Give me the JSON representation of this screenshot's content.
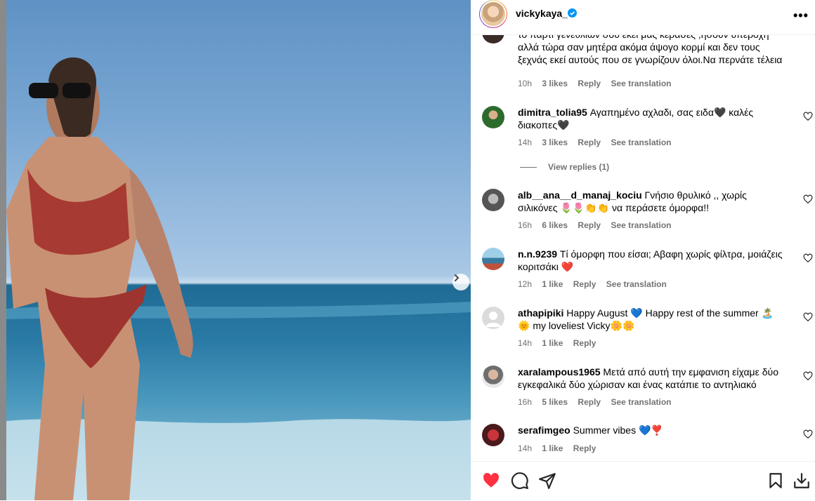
{
  "post": {
    "username": "vickykaya_",
    "verified": true,
    "more_icon": "more-horizontal-icon"
  },
  "comments": [
    {
      "text": "το πάρτι γενεθλίων σου εκεί μας κερασες ,ήσουν υπέροχη αλλά τώρα σαν μητέρα ακόμα άψογο κορμί και δεν τους ξεχνάς εκεί αυτούς που σε γνωρίζουν όλοι.Να περνάτε τέλεια",
      "time": "10h",
      "likes": "3 likes",
      "reply": "Reply",
      "translation": "See translation"
    },
    {
      "user": "dimitra_tolia95",
      "text": "Αγαπημένο αχλαδι, σας ειδα🖤 καλές διακοπες🖤",
      "time": "14h",
      "likes": "3 likes",
      "reply": "Reply",
      "translation": "See translation",
      "view_replies": "View replies (1)"
    },
    {
      "user": "alb__ana__d_manaj_kociu",
      "text": "Γνήσιο θρυλικό ,, χωρίς σιλικόνες 🌷🌷👏👏 να περάσετε όμορφα!!",
      "time": "16h",
      "likes": "6 likes",
      "reply": "Reply",
      "translation": "See translation"
    },
    {
      "user": "n.n.9239",
      "text": "Τί όμορφη που είσαι; Αβαφη χωρίς φίλτρα, μοιάζεις κοριτσάκι ❤️",
      "time": "12h",
      "likes": "1 like",
      "reply": "Reply",
      "translation": "See translation"
    },
    {
      "user": "athapipiki",
      "text": "Happy August 💙 Happy rest of the summer 🏝️🌞 my loveliest Vicky🌼🌼",
      "time": "14h",
      "likes": "1 like",
      "reply": "Reply"
    },
    {
      "user": "xaralampous1965",
      "text": "Μετά από αυτή την εμφανιση είχαμε δύο εγκεφαλικά δύο χώρισαν και ένας κατάπιε το αντηλιακό",
      "time": "16h",
      "likes": "5 likes",
      "reply": "Reply",
      "translation": "See translation"
    },
    {
      "user": "serafimgeo",
      "text": "Summer vibes 💙❣️",
      "time": "14h",
      "likes": "1 like",
      "reply": "Reply"
    }
  ],
  "actions": {
    "like_icon": "heart-filled-icon",
    "comment_icon": "comment-icon",
    "share_icon": "share-icon",
    "save_icon": "bookmark-icon",
    "download_icon": "download-icon",
    "like_color": "#ff3040"
  }
}
